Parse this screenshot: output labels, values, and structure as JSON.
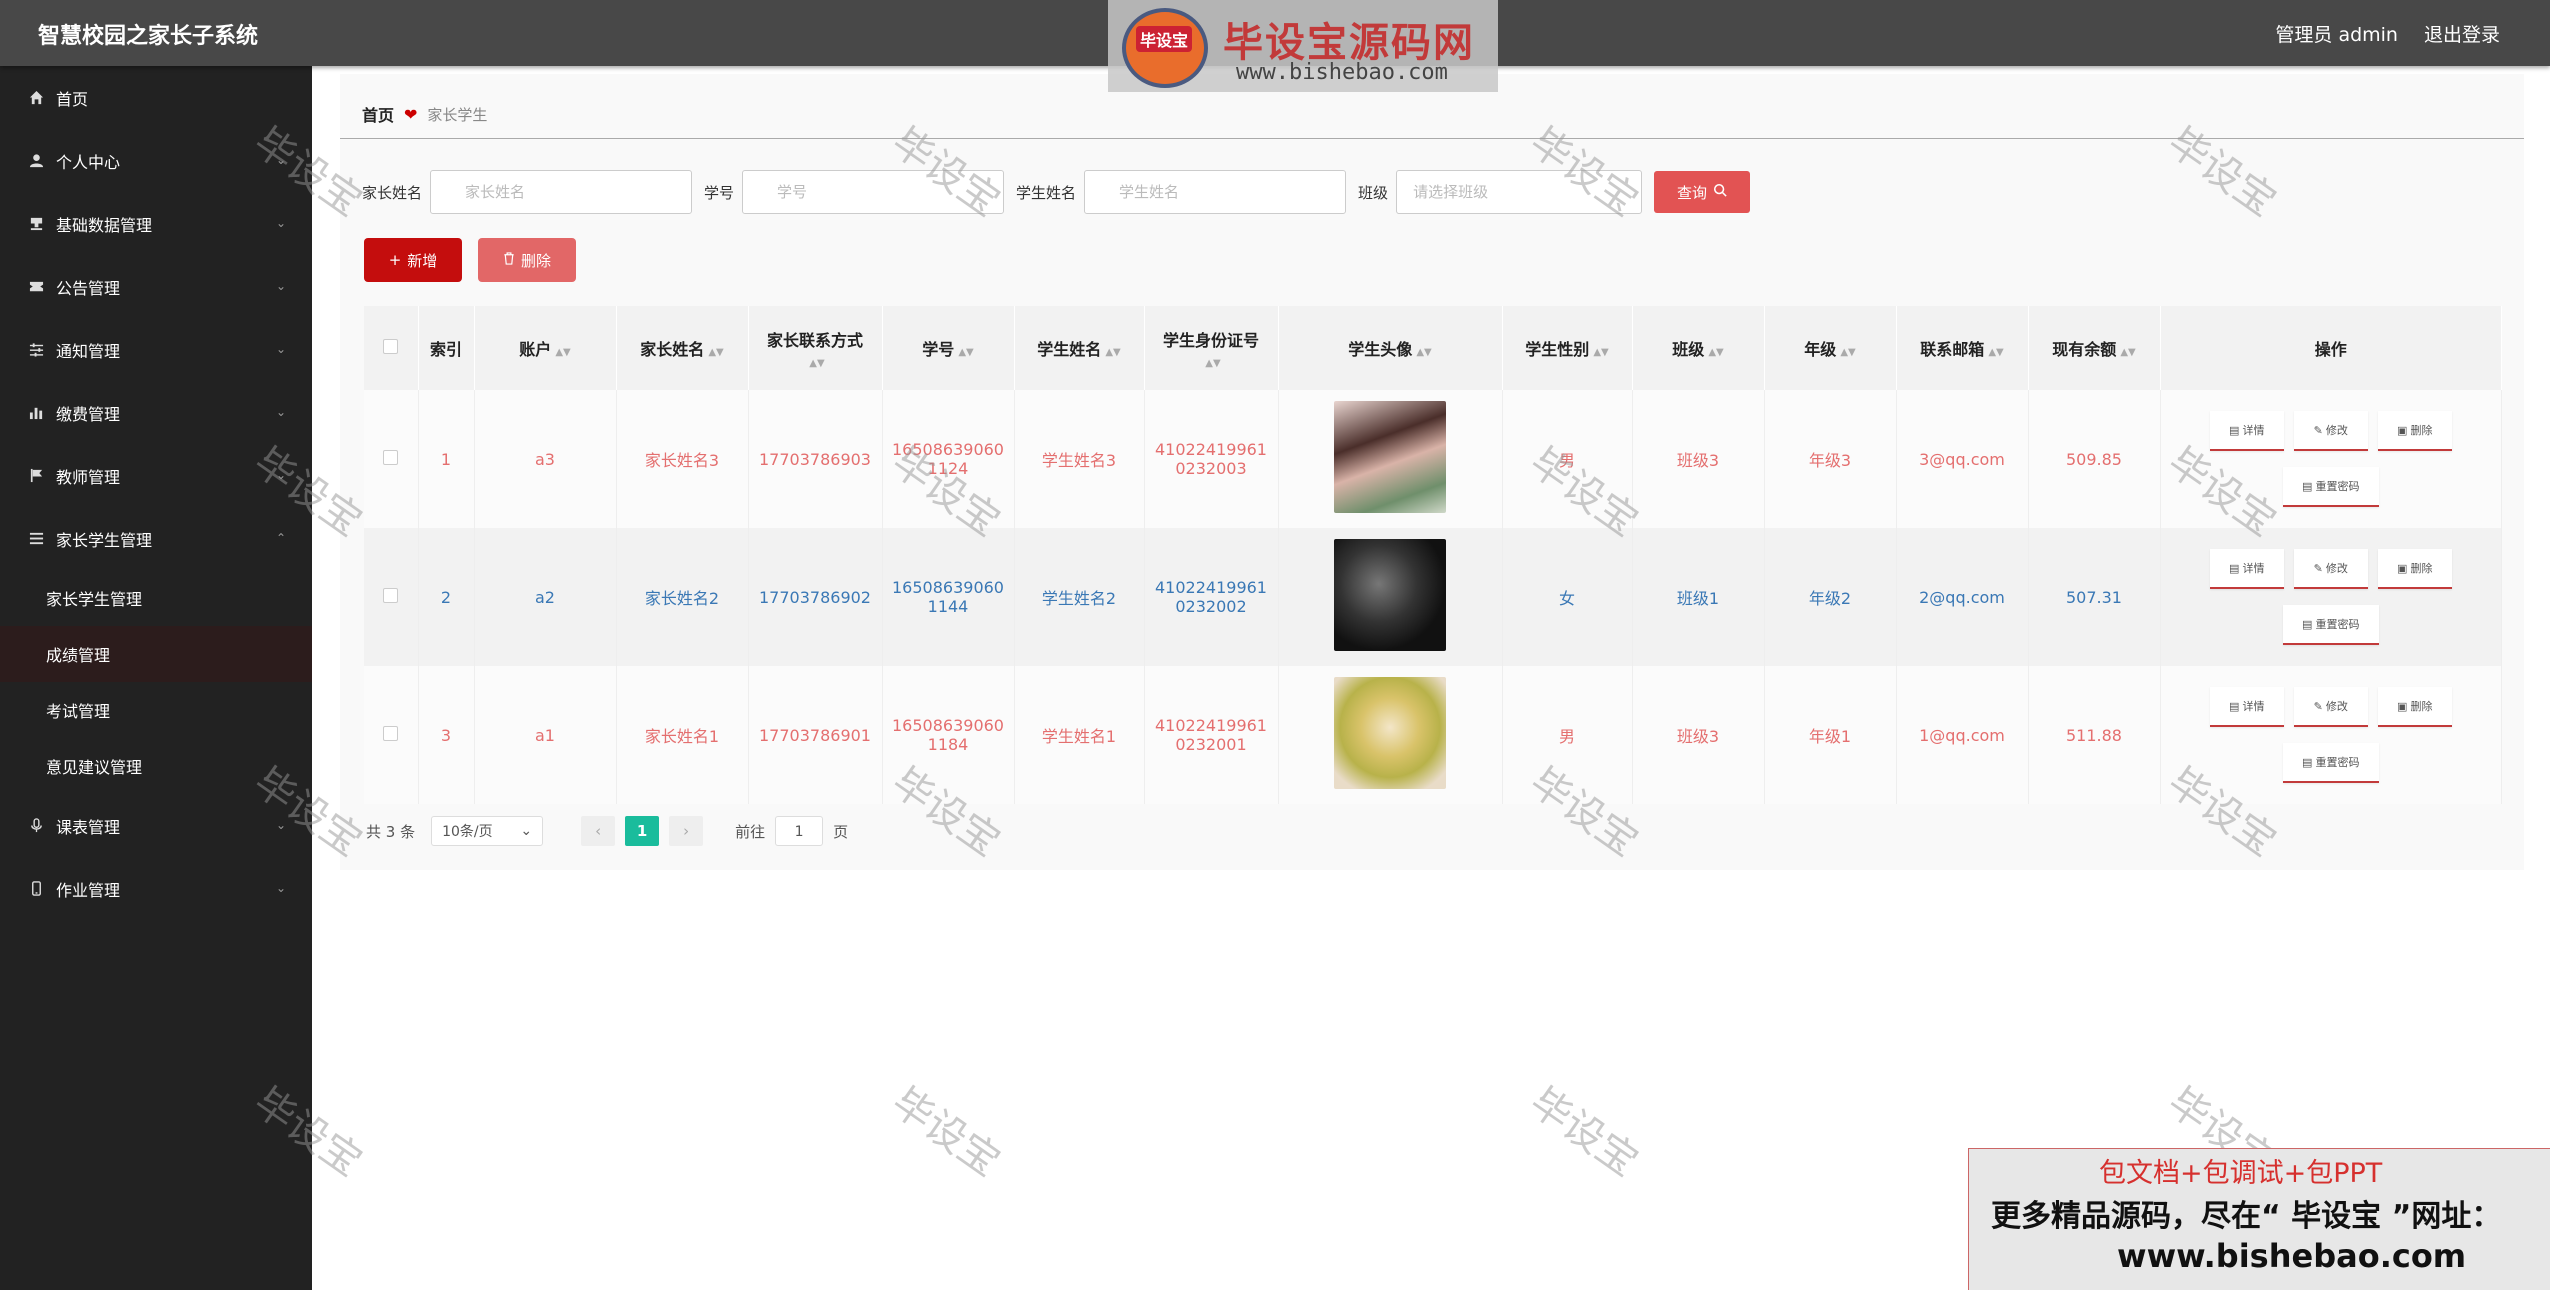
{
  "app": {
    "title": "智慧校园之家长子系统"
  },
  "top": {
    "user": "管理员 admin",
    "logout": "退出登录"
  },
  "watermark_logo": {
    "badge": "毕设宝",
    "title": "毕设宝源码网",
    "url": "www.bishebao.com"
  },
  "sidebar": {
    "items": [
      {
        "label": "首页",
        "icon": "home-icon"
      },
      {
        "label": "个人中心",
        "icon": "user-icon"
      },
      {
        "label": "基础数据管理",
        "icon": "stamp-icon"
      },
      {
        "label": "公告管理",
        "icon": "ticket-icon"
      },
      {
        "label": "通知管理",
        "icon": "sliders-icon"
      },
      {
        "label": "缴费管理",
        "icon": "chart-icon"
      },
      {
        "label": "教师管理",
        "icon": "flag-icon"
      },
      {
        "label": "家长学生管理",
        "icon": "menu-icon"
      }
    ],
    "subitems": [
      "家长学生管理",
      "成绩管理",
      "考试管理",
      "意见建议管理"
    ],
    "items_after": [
      {
        "label": "课表管理",
        "icon": "mic-icon"
      },
      {
        "label": "作业管理",
        "icon": "phone-icon"
      }
    ]
  },
  "breadcrumb": {
    "home": "首页",
    "current": "家长学生"
  },
  "search": {
    "parent_label": "家长姓名",
    "parent_placeholder": "家长姓名",
    "id_label": "学号",
    "id_placeholder": "学号",
    "student_label": "学生姓名",
    "student_placeholder": "学生姓名",
    "class_label": "班级",
    "class_placeholder": "请选择班级",
    "query_button": "查询"
  },
  "actions": {
    "add": "新增",
    "delete": "删除"
  },
  "table": {
    "headers": [
      "索引",
      "账户",
      "家长姓名",
      "家长联系方式",
      "学号",
      "学生姓名",
      "学生身份证号",
      "学生头像",
      "学生性别",
      "班级",
      "年级",
      "联系邮箱",
      "现有余额",
      "操作"
    ],
    "rows": [
      {
        "index": "1",
        "account": "a3",
        "parent": "家长姓名3",
        "phone": "17703786903",
        "sid1": "16508639060",
        "sid2": "1124",
        "student": "学生姓名3",
        "idno1": "41022419961",
        "idno2": "0232003",
        "gender": "男",
        "class": "班级3",
        "grade": "年级3",
        "email": "3@qq.com",
        "balance": "509.85"
      },
      {
        "index": "2",
        "account": "a2",
        "parent": "家长姓名2",
        "phone": "17703786902",
        "sid1": "16508639060",
        "sid2": "1144",
        "student": "学生姓名2",
        "idno1": "41022419961",
        "idno2": "0232002",
        "gender": "女",
        "class": "班级1",
        "grade": "年级2",
        "email": "2@qq.com",
        "balance": "507.31"
      },
      {
        "index": "3",
        "account": "a1",
        "parent": "家长姓名1",
        "phone": "17703786901",
        "sid1": "16508639060",
        "sid2": "1184",
        "student": "学生姓名1",
        "idno1": "41022419961",
        "idno2": "0232001",
        "gender": "男",
        "class": "班级3",
        "grade": "年级1",
        "email": "1@qq.com",
        "balance": "511.88"
      }
    ],
    "ops": {
      "detail": "详情",
      "edit": "修改",
      "delete": "删除",
      "reset": "重置密码"
    }
  },
  "pager": {
    "total": "共 3 条",
    "page_size": "10条/页",
    "current": "1",
    "goto": "前往",
    "goto_value": "1",
    "page_unit": "页"
  },
  "watermark_text": "毕设宝",
  "promo": {
    "line1": "包文档+包调试+包PPT",
    "line2": "更多精品源码，尽在“ 毕设宝 ”网址：",
    "line3": "www.bishebao.com"
  },
  "colors": {
    "accent": "#c40d0d",
    "odd_text": "#e46f6f",
    "even_text": "#3a78b5",
    "pager": "#1abc9c"
  }
}
